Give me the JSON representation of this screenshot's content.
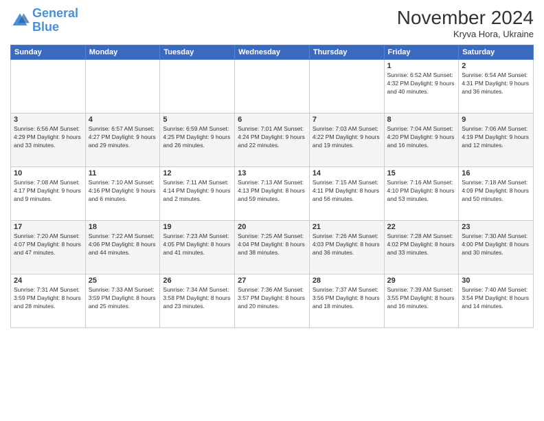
{
  "logo": {
    "line1": "General",
    "line2": "Blue"
  },
  "title": "November 2024",
  "location": "Kryva Hora, Ukraine",
  "days_of_week": [
    "Sunday",
    "Monday",
    "Tuesday",
    "Wednesday",
    "Thursday",
    "Friday",
    "Saturday"
  ],
  "weeks": [
    [
      {
        "day": "",
        "info": ""
      },
      {
        "day": "",
        "info": ""
      },
      {
        "day": "",
        "info": ""
      },
      {
        "day": "",
        "info": ""
      },
      {
        "day": "",
        "info": ""
      },
      {
        "day": "1",
        "info": "Sunrise: 6:52 AM\nSunset: 4:32 PM\nDaylight: 9 hours\nand 40 minutes."
      },
      {
        "day": "2",
        "info": "Sunrise: 6:54 AM\nSunset: 4:31 PM\nDaylight: 9 hours\nand 36 minutes."
      }
    ],
    [
      {
        "day": "3",
        "info": "Sunrise: 6:56 AM\nSunset: 4:29 PM\nDaylight: 9 hours\nand 33 minutes."
      },
      {
        "day": "4",
        "info": "Sunrise: 6:57 AM\nSunset: 4:27 PM\nDaylight: 9 hours\nand 29 minutes."
      },
      {
        "day": "5",
        "info": "Sunrise: 6:59 AM\nSunset: 4:25 PM\nDaylight: 9 hours\nand 26 minutes."
      },
      {
        "day": "6",
        "info": "Sunrise: 7:01 AM\nSunset: 4:24 PM\nDaylight: 9 hours\nand 22 minutes."
      },
      {
        "day": "7",
        "info": "Sunrise: 7:03 AM\nSunset: 4:22 PM\nDaylight: 9 hours\nand 19 minutes."
      },
      {
        "day": "8",
        "info": "Sunrise: 7:04 AM\nSunset: 4:20 PM\nDaylight: 9 hours\nand 16 minutes."
      },
      {
        "day": "9",
        "info": "Sunrise: 7:06 AM\nSunset: 4:19 PM\nDaylight: 9 hours\nand 12 minutes."
      }
    ],
    [
      {
        "day": "10",
        "info": "Sunrise: 7:08 AM\nSunset: 4:17 PM\nDaylight: 9 hours\nand 9 minutes."
      },
      {
        "day": "11",
        "info": "Sunrise: 7:10 AM\nSunset: 4:16 PM\nDaylight: 9 hours\nand 6 minutes."
      },
      {
        "day": "12",
        "info": "Sunrise: 7:11 AM\nSunset: 4:14 PM\nDaylight: 9 hours\nand 2 minutes."
      },
      {
        "day": "13",
        "info": "Sunrise: 7:13 AM\nSunset: 4:13 PM\nDaylight: 8 hours\nand 59 minutes."
      },
      {
        "day": "14",
        "info": "Sunrise: 7:15 AM\nSunset: 4:11 PM\nDaylight: 8 hours\nand 56 minutes."
      },
      {
        "day": "15",
        "info": "Sunrise: 7:16 AM\nSunset: 4:10 PM\nDaylight: 8 hours\nand 53 minutes."
      },
      {
        "day": "16",
        "info": "Sunrise: 7:18 AM\nSunset: 4:09 PM\nDaylight: 8 hours\nand 50 minutes."
      }
    ],
    [
      {
        "day": "17",
        "info": "Sunrise: 7:20 AM\nSunset: 4:07 PM\nDaylight: 8 hours\nand 47 minutes."
      },
      {
        "day": "18",
        "info": "Sunrise: 7:22 AM\nSunset: 4:06 PM\nDaylight: 8 hours\nand 44 minutes."
      },
      {
        "day": "19",
        "info": "Sunrise: 7:23 AM\nSunset: 4:05 PM\nDaylight: 8 hours\nand 41 minutes."
      },
      {
        "day": "20",
        "info": "Sunrise: 7:25 AM\nSunset: 4:04 PM\nDaylight: 8 hours\nand 38 minutes."
      },
      {
        "day": "21",
        "info": "Sunrise: 7:26 AM\nSunset: 4:03 PM\nDaylight: 8 hours\nand 36 minutes."
      },
      {
        "day": "22",
        "info": "Sunrise: 7:28 AM\nSunset: 4:02 PM\nDaylight: 8 hours\nand 33 minutes."
      },
      {
        "day": "23",
        "info": "Sunrise: 7:30 AM\nSunset: 4:00 PM\nDaylight: 8 hours\nand 30 minutes."
      }
    ],
    [
      {
        "day": "24",
        "info": "Sunrise: 7:31 AM\nSunset: 3:59 PM\nDaylight: 8 hours\nand 28 minutes."
      },
      {
        "day": "25",
        "info": "Sunrise: 7:33 AM\nSunset: 3:59 PM\nDaylight: 8 hours\nand 25 minutes."
      },
      {
        "day": "26",
        "info": "Sunrise: 7:34 AM\nSunset: 3:58 PM\nDaylight: 8 hours\nand 23 minutes."
      },
      {
        "day": "27",
        "info": "Sunrise: 7:36 AM\nSunset: 3:57 PM\nDaylight: 8 hours\nand 20 minutes."
      },
      {
        "day": "28",
        "info": "Sunrise: 7:37 AM\nSunset: 3:56 PM\nDaylight: 8 hours\nand 18 minutes."
      },
      {
        "day": "29",
        "info": "Sunrise: 7:39 AM\nSunset: 3:55 PM\nDaylight: 8 hours\nand 16 minutes."
      },
      {
        "day": "30",
        "info": "Sunrise: 7:40 AM\nSunset: 3:54 PM\nDaylight: 8 hours\nand 14 minutes."
      }
    ]
  ]
}
